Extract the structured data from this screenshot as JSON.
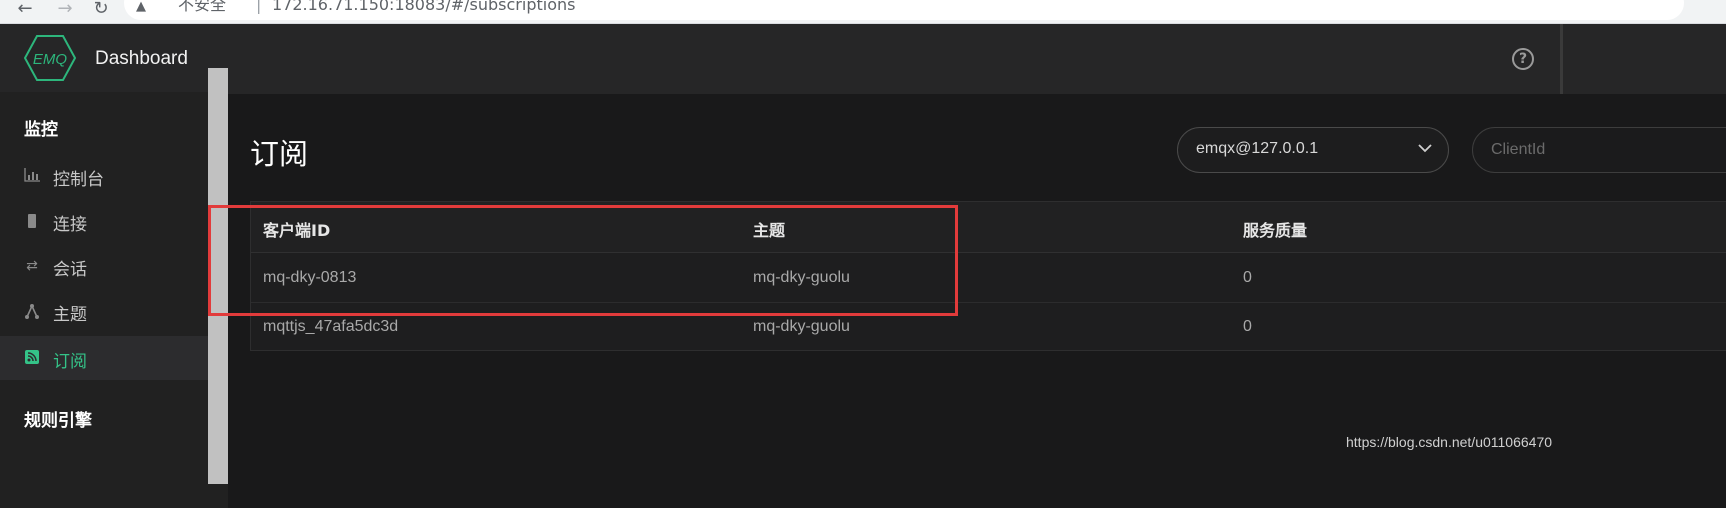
{
  "browser": {
    "security_label": "不安全",
    "separator": "|",
    "url": "172.16.71.150:18083/#/subscriptions"
  },
  "app": {
    "logo_text": "EMQ",
    "title": "Dashboard"
  },
  "sidebar": {
    "sections": [
      {
        "label": "监控",
        "items": [
          {
            "label": "控制台",
            "icon": "bar-chart-icon"
          },
          {
            "label": "连接",
            "icon": "chip-icon"
          },
          {
            "label": "会话",
            "icon": "swap-arrows-icon"
          },
          {
            "label": "主题",
            "icon": "topic-nodes-icon"
          },
          {
            "label": "订阅",
            "icon": "rss-icon",
            "active": true
          }
        ]
      },
      {
        "label": "规则引擎",
        "items": []
      }
    ]
  },
  "header": {
    "help_icon": "help-circle-icon"
  },
  "main": {
    "title": "订阅",
    "node_select": {
      "value": "emqx@127.0.0.1"
    },
    "client_filter": {
      "placeholder": "ClientId"
    },
    "table": {
      "columns": [
        "客户端ID",
        "主题",
        "服务质量"
      ],
      "rows": [
        [
          "mq-dky-0813",
          "mq-dky-guolu",
          "0"
        ],
        [
          "mqttjs_47afa5dc3d",
          "mq-dky-guolu",
          "0"
        ]
      ]
    }
  },
  "watermark": "https://blog.csdn.net/u011066470",
  "colors": {
    "accent": "#34c388",
    "highlight": "#e23b3b"
  }
}
